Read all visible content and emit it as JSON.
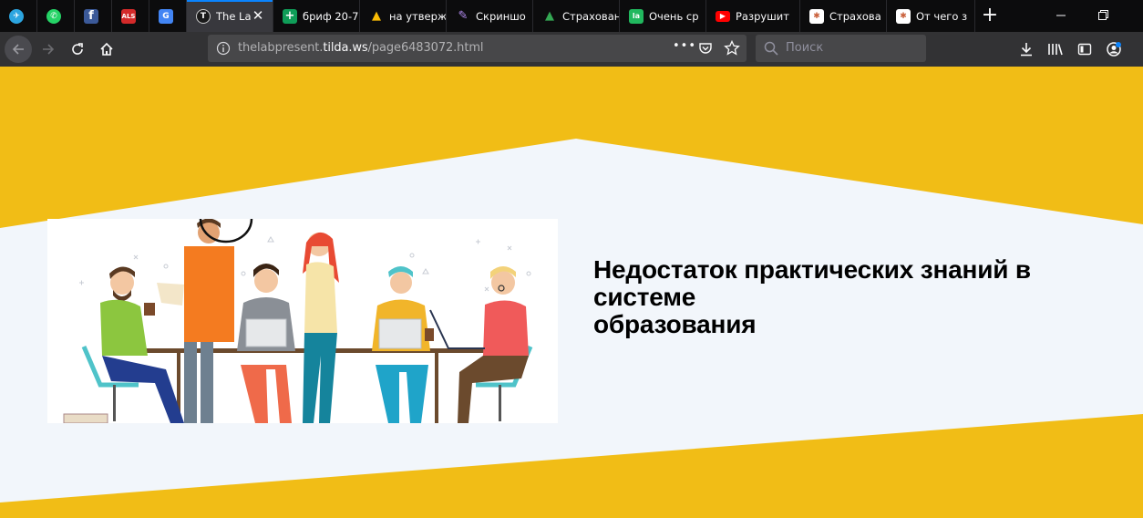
{
  "browser": {
    "tabs": [
      {
        "title": "",
        "icon": "telegram-icon",
        "color": "#2ca5e0",
        "glyph": "✈"
      },
      {
        "title": "",
        "icon": "whatsapp-icon",
        "color": "#25d366",
        "glyph": "✆"
      },
      {
        "title": "",
        "icon": "facebook-icon",
        "color": "#3b5998",
        "glyph": "f"
      },
      {
        "title": "",
        "icon": "als-icon",
        "color": "#d42a2a",
        "glyph": "ALS"
      },
      {
        "title": "",
        "icon": "translate-icon",
        "color": "#4285f4",
        "glyph": "G"
      },
      {
        "title": "The La",
        "icon": "tilda-icon",
        "color": "#1a1a1a",
        "glyph": "T"
      },
      {
        "title": "бриф 20-7",
        "icon": "sheets-icon",
        "color": "#0f9d58",
        "glyph": "+"
      },
      {
        "title": "на утверж",
        "icon": "drive-icon",
        "color": "#fbbc04",
        "glyph": "▲"
      },
      {
        "title": "Скриншо",
        "icon": "feather-icon",
        "color": "#7b4fd1",
        "glyph": "✎"
      },
      {
        "title": "Страхован",
        "icon": "drive-icon",
        "color": "#34a853",
        "glyph": "▲"
      },
      {
        "title": "Очень ср",
        "icon": "la-icon",
        "color": "#21b85e",
        "glyph": "la"
      },
      {
        "title": "Разрушит",
        "icon": "youtube-icon",
        "color": "#ff0000",
        "glyph": "▶"
      },
      {
        "title": "Страхова",
        "icon": "site-icon",
        "color": "#c9603b",
        "glyph": "✱"
      },
      {
        "title": "От чего з",
        "icon": "site-icon",
        "color": "#c9603b",
        "glyph": "✱"
      }
    ],
    "url_prefix": "thelabpresent.",
    "url_host": "tilda.ws",
    "url_path": "/page6483072.html",
    "search_placeholder": "Поиск",
    "page_actions": "•••"
  },
  "page": {
    "heading_line1": "Недостаток практических знаний в системе",
    "heading_line2": "образования",
    "colors": {
      "yellow": "#f1bd16",
      "band": "#f2f6fb"
    }
  }
}
